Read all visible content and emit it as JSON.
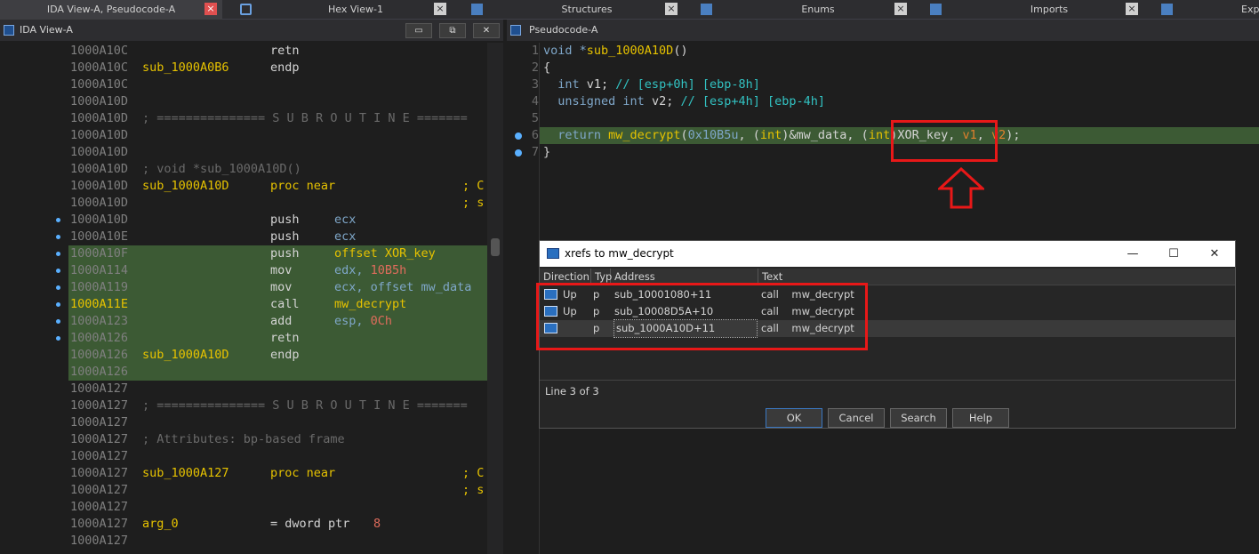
{
  "tabs": [
    {
      "label": "IDA View-A, Pseudocode-A",
      "active": true
    },
    {
      "label": "Hex View-1"
    },
    {
      "label": "Structures"
    },
    {
      "label": "Enums"
    },
    {
      "label": "Imports"
    },
    {
      "label": "Exp"
    }
  ],
  "left_pane": {
    "title": "IDA View-A",
    "rows": [
      {
        "addr": "1000A10C",
        "label": "",
        "mn": "retn",
        "op": ""
      },
      {
        "addr": "1000A10C",
        "label": "sub_1000A0B6",
        "mn": "endp",
        "op": ""
      },
      {
        "addr": "1000A10C",
        "label": "",
        "mn": "",
        "op": ""
      },
      {
        "addr": "1000A10D",
        "label": "",
        "mn": "",
        "op": ""
      },
      {
        "addr": "1000A10D",
        "comment": "; =============== S U B R O U T I N E ======="
      },
      {
        "addr": "1000A10D",
        "label": "",
        "mn": "",
        "op": ""
      },
      {
        "addr": "1000A10D",
        "label": "",
        "mn": "",
        "op": ""
      },
      {
        "addr": "1000A10D",
        "comment": "; void *sub_1000A10D()"
      },
      {
        "addr": "1000A10D",
        "label": "sub_1000A10D",
        "mn": "proc near",
        "op": "",
        "semi": "; C"
      },
      {
        "addr": "1000A10D",
        "label": "",
        "mn": "",
        "op": "",
        "semi": "; s"
      },
      {
        "addr": "1000A10D",
        "label": "",
        "mn": "push",
        "op": "ecx"
      },
      {
        "addr": "1000A10E",
        "label": "",
        "mn": "push",
        "op": "ecx"
      },
      {
        "addr": "1000A10F",
        "label": "",
        "mn": "push",
        "op": "offset XOR_key"
      },
      {
        "addr": "1000A114",
        "label": "",
        "mn": "mov",
        "op": "edx, ",
        "num": "10B5h"
      },
      {
        "addr": "1000A119",
        "label": "",
        "mn": "mov",
        "op": "ecx, offset mw_data"
      },
      {
        "addr": "1000A11E",
        "label": "",
        "mn": "call",
        "op": "mw_decrypt"
      },
      {
        "addr": "1000A123",
        "label": "",
        "mn": "add",
        "op": "esp, ",
        "num": "0Ch"
      },
      {
        "addr": "1000A126",
        "label": "",
        "mn": "retn",
        "op": ""
      },
      {
        "addr": "1000A126",
        "label": "sub_1000A10D",
        "mn": "endp",
        "op": ""
      },
      {
        "addr": "1000A126",
        "label": "",
        "mn": "",
        "op": ""
      },
      {
        "addr": "1000A127",
        "label": "",
        "mn": "",
        "op": ""
      },
      {
        "addr": "1000A127",
        "comment": "; =============== S U B R O U T I N E ======="
      },
      {
        "addr": "1000A127",
        "label": "",
        "mn": "",
        "op": ""
      },
      {
        "addr": "1000A127",
        "comment": "; Attributes: bp-based frame"
      },
      {
        "addr": "1000A127",
        "label": "",
        "mn": "",
        "op": ""
      },
      {
        "addr": "1000A127",
        "label": "sub_1000A127",
        "mn": "proc near",
        "op": "",
        "semi": "; C"
      },
      {
        "addr": "1000A127",
        "label": "",
        "mn": "",
        "op": "",
        "semi": "; s"
      },
      {
        "addr": "1000A127",
        "label": "",
        "mn": "",
        "op": ""
      },
      {
        "addr": "1000A127",
        "label": "arg_0",
        "mn": "= dword ptr",
        "op": "",
        "num": "8"
      },
      {
        "addr": "1000A127",
        "label": "",
        "mn": "",
        "op": ""
      }
    ]
  },
  "right_pane": {
    "title": "Pseudocode-A",
    "lines": [
      {
        "n": "1",
        "parts": [
          [
            "kw",
            "void *"
          ],
          [
            "fn",
            "sub_1000A10D"
          ],
          [
            "nm",
            "()"
          ]
        ]
      },
      {
        "n": "2",
        "parts": [
          [
            "nm",
            "{"
          ]
        ]
      },
      {
        "n": "3",
        "parts": [
          [
            "nm",
            "  "
          ],
          [
            "kw",
            "int "
          ],
          [
            "nm",
            "v1; "
          ],
          [
            "cm2",
            "// [esp+0h] [ebp-8h]"
          ]
        ]
      },
      {
        "n": "4",
        "parts": [
          [
            "nm",
            "  "
          ],
          [
            "kw",
            "unsigned int "
          ],
          [
            "nm",
            "v2; "
          ],
          [
            "cm2",
            "// [esp+4h] [ebp-4h]"
          ]
        ]
      },
      {
        "n": "5",
        "parts": [
          [
            "nm",
            ""
          ]
        ]
      },
      {
        "n": "6",
        "parts": [
          [
            "nm",
            "  "
          ],
          [
            "kw",
            "return "
          ],
          [
            "fn",
            "mw_decrypt"
          ],
          [
            "nm",
            "("
          ],
          [
            "kw",
            "0x10B5u"
          ],
          [
            "nm",
            ", ("
          ],
          [
            "ty",
            "int"
          ],
          [
            "nm",
            ")&mw_data, ("
          ],
          [
            "ty",
            "int"
          ],
          [
            "nm",
            ")XOR_key, "
          ],
          [
            "vr",
            "v1"
          ],
          [
            "nm",
            ", "
          ],
          [
            "vr",
            "v2"
          ],
          [
            "nm",
            ");"
          ]
        ]
      },
      {
        "n": "7",
        "parts": [
          [
            "nm",
            "}"
          ]
        ]
      }
    ]
  },
  "dialog": {
    "title": "xrefs to mw_decrypt",
    "columns": [
      "Direction",
      "Typ",
      "Address",
      "Text"
    ],
    "rows": [
      {
        "dir": "Up",
        "typ": "p",
        "addr": "sub_10001080+11",
        "text": "call    mw_decrypt"
      },
      {
        "dir": "Up",
        "typ": "p",
        "addr": "sub_10008D5A+10",
        "text": "call    mw_decrypt"
      },
      {
        "dir": "",
        "typ": "p",
        "addr": "sub_1000A10D+11",
        "text": "call    mw_decrypt"
      }
    ],
    "status": "Line 3 of 3",
    "buttons": [
      "OK",
      "Cancel",
      "Search",
      "Help"
    ]
  },
  "colors": {
    "highlight": "#3c5a34",
    "annotation": "#e81818",
    "label": "#e6c200"
  }
}
